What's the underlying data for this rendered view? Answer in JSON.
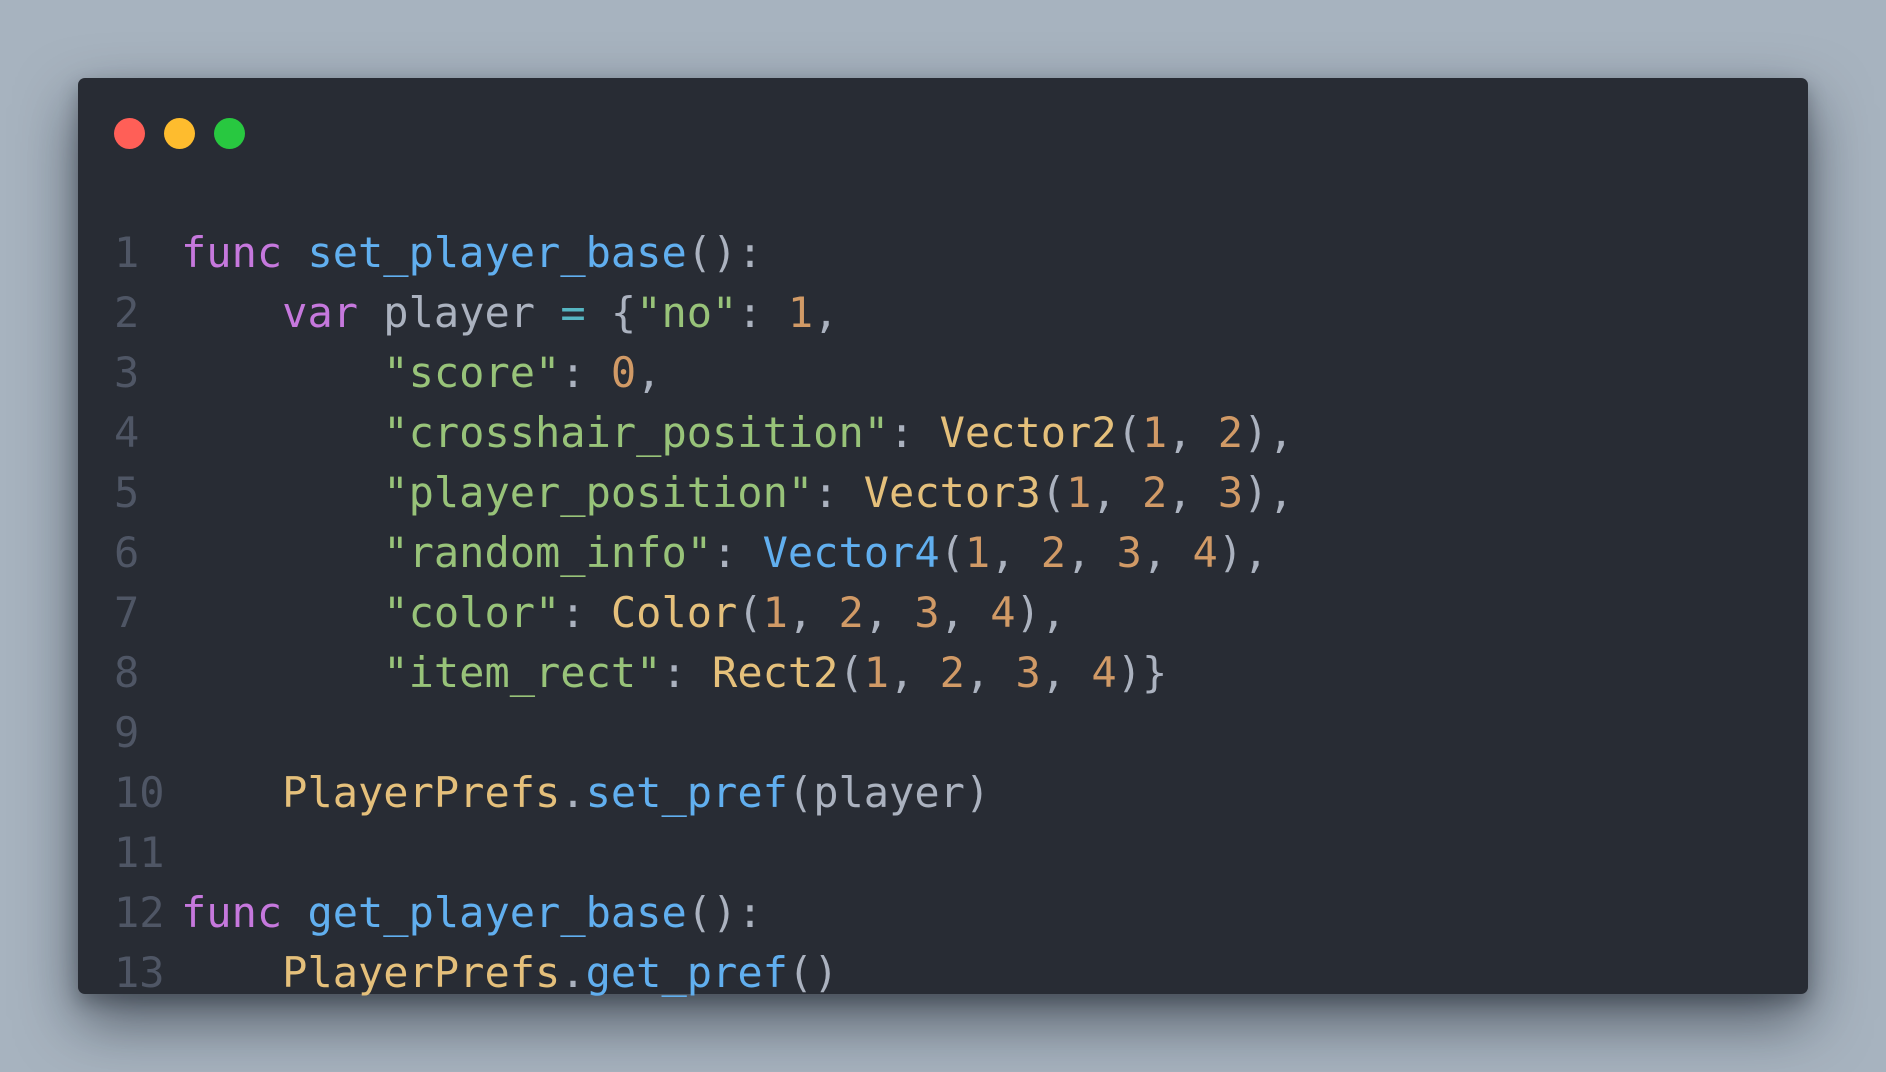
{
  "window": {
    "controls": [
      {
        "name": "close",
        "color": "#ff5f57"
      },
      {
        "name": "minimize",
        "color": "#febc2e"
      },
      {
        "name": "zoom",
        "color": "#28c840"
      }
    ]
  },
  "colors": {
    "keyword": "#c678dd",
    "function": "#61afef",
    "string": "#98c379",
    "number": "#d19a66",
    "class": "#e5c07b",
    "operator": "#56b6c2",
    "plain": "#abb2bf",
    "line_number": "#4f5665",
    "background": "#282c34"
  },
  "code": {
    "lines": [
      {
        "n": "1",
        "tokens": [
          {
            "t": "func",
            "c": "kw"
          },
          {
            "t": " ",
            "c": "plain"
          },
          {
            "t": "set_player_base",
            "c": "fn"
          },
          {
            "t": "():",
            "c": "plain"
          }
        ]
      },
      {
        "n": "2",
        "tokens": [
          {
            "t": "    ",
            "c": "plain"
          },
          {
            "t": "var",
            "c": "kw"
          },
          {
            "t": " player ",
            "c": "plain"
          },
          {
            "t": "=",
            "c": "op"
          },
          {
            "t": " {",
            "c": "plain"
          },
          {
            "t": "\"no\"",
            "c": "str"
          },
          {
            "t": ": ",
            "c": "plain"
          },
          {
            "t": "1",
            "c": "num"
          },
          {
            "t": ",",
            "c": "plain"
          }
        ]
      },
      {
        "n": "3",
        "tokens": [
          {
            "t": "        ",
            "c": "plain"
          },
          {
            "t": "\"score\"",
            "c": "str"
          },
          {
            "t": ": ",
            "c": "plain"
          },
          {
            "t": "0",
            "c": "num"
          },
          {
            "t": ",",
            "c": "plain"
          }
        ]
      },
      {
        "n": "4",
        "tokens": [
          {
            "t": "        ",
            "c": "plain"
          },
          {
            "t": "\"crosshair_position\"",
            "c": "str"
          },
          {
            "t": ": ",
            "c": "plain"
          },
          {
            "t": "Vector2",
            "c": "cls"
          },
          {
            "t": "(",
            "c": "plain"
          },
          {
            "t": "1",
            "c": "num"
          },
          {
            "t": ", ",
            "c": "plain"
          },
          {
            "t": "2",
            "c": "num"
          },
          {
            "t": "),",
            "c": "plain"
          }
        ]
      },
      {
        "n": "5",
        "tokens": [
          {
            "t": "        ",
            "c": "plain"
          },
          {
            "t": "\"player_position\"",
            "c": "str"
          },
          {
            "t": ": ",
            "c": "plain"
          },
          {
            "t": "Vector3",
            "c": "cls"
          },
          {
            "t": "(",
            "c": "plain"
          },
          {
            "t": "1",
            "c": "num"
          },
          {
            "t": ", ",
            "c": "plain"
          },
          {
            "t": "2",
            "c": "num"
          },
          {
            "t": ", ",
            "c": "plain"
          },
          {
            "t": "3",
            "c": "num"
          },
          {
            "t": "),",
            "c": "plain"
          }
        ]
      },
      {
        "n": "6",
        "tokens": [
          {
            "t": "        ",
            "c": "plain"
          },
          {
            "t": "\"random_info\"",
            "c": "str"
          },
          {
            "t": ": ",
            "c": "plain"
          },
          {
            "t": "Vector4",
            "c": "fn"
          },
          {
            "t": "(",
            "c": "plain"
          },
          {
            "t": "1",
            "c": "num"
          },
          {
            "t": ", ",
            "c": "plain"
          },
          {
            "t": "2",
            "c": "num"
          },
          {
            "t": ", ",
            "c": "plain"
          },
          {
            "t": "3",
            "c": "num"
          },
          {
            "t": ", ",
            "c": "plain"
          },
          {
            "t": "4",
            "c": "num"
          },
          {
            "t": "),",
            "c": "plain"
          }
        ]
      },
      {
        "n": "7",
        "tokens": [
          {
            "t": "        ",
            "c": "plain"
          },
          {
            "t": "\"color\"",
            "c": "str"
          },
          {
            "t": ": ",
            "c": "plain"
          },
          {
            "t": "Color",
            "c": "cls"
          },
          {
            "t": "(",
            "c": "plain"
          },
          {
            "t": "1",
            "c": "num"
          },
          {
            "t": ", ",
            "c": "plain"
          },
          {
            "t": "2",
            "c": "num"
          },
          {
            "t": ", ",
            "c": "plain"
          },
          {
            "t": "3",
            "c": "num"
          },
          {
            "t": ", ",
            "c": "plain"
          },
          {
            "t": "4",
            "c": "num"
          },
          {
            "t": "),",
            "c": "plain"
          }
        ]
      },
      {
        "n": "8",
        "tokens": [
          {
            "t": "        ",
            "c": "plain"
          },
          {
            "t": "\"item_rect\"",
            "c": "str"
          },
          {
            "t": ": ",
            "c": "plain"
          },
          {
            "t": "Rect2",
            "c": "cls"
          },
          {
            "t": "(",
            "c": "plain"
          },
          {
            "t": "1",
            "c": "num"
          },
          {
            "t": ", ",
            "c": "plain"
          },
          {
            "t": "2",
            "c": "num"
          },
          {
            "t": ", ",
            "c": "plain"
          },
          {
            "t": "3",
            "c": "num"
          },
          {
            "t": ", ",
            "c": "plain"
          },
          {
            "t": "4",
            "c": "num"
          },
          {
            "t": ")}",
            "c": "plain"
          }
        ]
      },
      {
        "n": "9",
        "tokens": []
      },
      {
        "n": "10",
        "tokens": [
          {
            "t": "    ",
            "c": "plain"
          },
          {
            "t": "PlayerPrefs",
            "c": "cls"
          },
          {
            "t": ".",
            "c": "plain"
          },
          {
            "t": "set_pref",
            "c": "fn"
          },
          {
            "t": "(player)",
            "c": "plain"
          }
        ]
      },
      {
        "n": "11",
        "tokens": []
      },
      {
        "n": "12",
        "tokens": [
          {
            "t": "func",
            "c": "kw"
          },
          {
            "t": " ",
            "c": "plain"
          },
          {
            "t": "get_player_base",
            "c": "fn"
          },
          {
            "t": "():",
            "c": "plain"
          }
        ]
      },
      {
        "n": "13",
        "tokens": [
          {
            "t": "    ",
            "c": "plain"
          },
          {
            "t": "PlayerPrefs",
            "c": "cls"
          },
          {
            "t": ".",
            "c": "plain"
          },
          {
            "t": "get_pref",
            "c": "fn"
          },
          {
            "t": "()",
            "c": "plain"
          }
        ]
      }
    ]
  }
}
